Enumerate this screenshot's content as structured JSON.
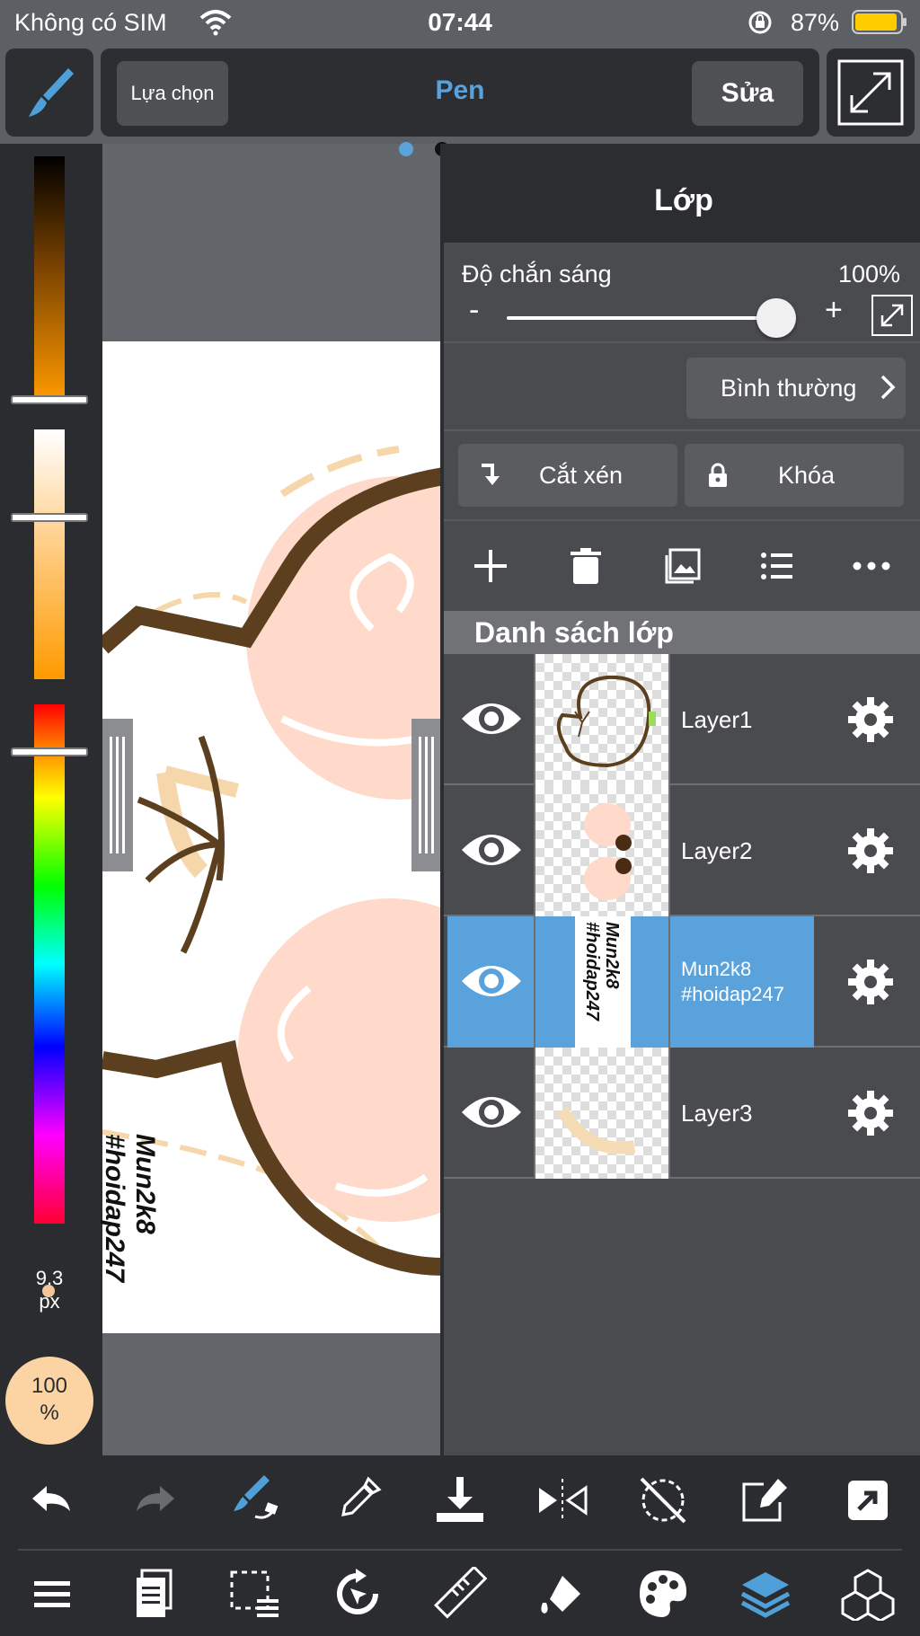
{
  "status_bar": {
    "carrier": "Không có SIM",
    "time": "07:44",
    "battery": "87%"
  },
  "toolbar": {
    "selection_label": "Lựa chọn",
    "tool_name": "Pen",
    "edit_label": "Sửa"
  },
  "color_panel": {
    "brush_size": "9.3\npx",
    "opacity": "100\n%"
  },
  "canvas": {
    "watermark": "Mun2k8\n#hoidap247"
  },
  "layer_panel": {
    "title": "Lớp",
    "opacity_label": "Độ chắn sáng",
    "opacity_value": "100%",
    "opacity_level": 1.0,
    "minus": "-",
    "plus": "+",
    "blend_mode": "Bình thường",
    "clip_label": "Cắt xén",
    "lock_label": "Khóa",
    "list_header": "Danh sách lớp",
    "layers": [
      {
        "name": "Layer1",
        "visible": true,
        "selected": false
      },
      {
        "name": "Layer2",
        "visible": true,
        "selected": false
      },
      {
        "name": "Mun2k8\n#hoidap247",
        "visible": true,
        "selected": true
      },
      {
        "name": "Layer3",
        "visible": true,
        "selected": false
      }
    ],
    "thumb_text": "Mun2k8\n#hoidap247"
  },
  "colors": {
    "accent": "#5aa2dc",
    "panel_dark": "#2c2d30",
    "panel": "#4a4b4e",
    "current_color": "#fcd4a4"
  },
  "icons": {
    "top": [
      "brush-icon",
      "fullscreen-icon"
    ],
    "bottom_row1": [
      "undo-icon",
      "redo-icon",
      "brush-transform-icon",
      "eyedropper-icon",
      "save-icon",
      "flip-icon",
      "rotate-lock-icon",
      "edit-frame-icon",
      "share-icon"
    ],
    "bottom_row2": [
      "menu-icon",
      "pages-icon",
      "selection-icon",
      "transform-icon",
      "ruler-icon",
      "fill-icon",
      "palette-icon",
      "layers-icon",
      "materials-icon"
    ]
  }
}
